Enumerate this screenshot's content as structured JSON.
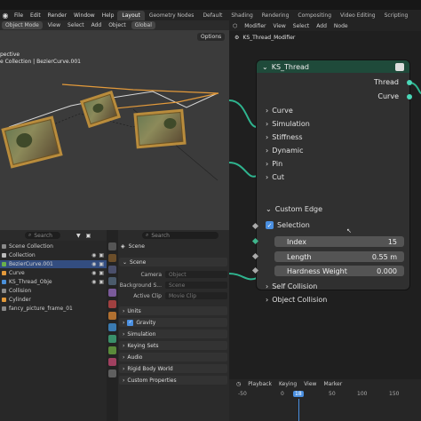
{
  "menubar": {
    "items": [
      "File",
      "Edit",
      "Render",
      "Window",
      "Help"
    ],
    "tabs": [
      "Layout",
      "Geometry Nodes",
      "Default",
      "Shading",
      "Rendering",
      "Compositing",
      "Video Editing",
      "Scripting"
    ],
    "active_tab": "Layout"
  },
  "viewport": {
    "mode": "Object Mode",
    "menus": [
      "View",
      "Select",
      "Add",
      "Object"
    ],
    "orientation": "Global",
    "options_label": "Options",
    "view_label": "pective",
    "collection_label": "e Collection | BezierCurve.001"
  },
  "outliner": {
    "search_placeholder": "Search",
    "rows": [
      {
        "label": "Scene Collection",
        "selected": false,
        "color": "#8a8a8a"
      },
      {
        "label": "Collection",
        "selected": false,
        "color": "#bbbbbb"
      },
      {
        "label": "BezierCurve.001",
        "selected": true,
        "color": "#6ab04c"
      },
      {
        "label": "Curve",
        "selected": false,
        "color": "#e39a3b"
      },
      {
        "label": "KS_Thread_Obje",
        "selected": false,
        "color": "#4a90d9"
      },
      {
        "label": "Collision",
        "selected": false,
        "color": "#8a8a8a"
      },
      {
        "label": "Cylinder",
        "selected": false,
        "color": "#e39a3b"
      },
      {
        "label": "fancy_picture_frame_01",
        "selected": false,
        "color": "#8a8a8a"
      }
    ]
  },
  "properties": {
    "search_placeholder": "Search",
    "scene_label": "Scene",
    "section_scene": "Scene",
    "fields": [
      {
        "label": "Camera",
        "value": "Object"
      },
      {
        "label": "Background S...",
        "value": "Scene"
      },
      {
        "label": "Active Clip",
        "value": "Movie Clip"
      }
    ],
    "sections": [
      "Units",
      "Gravity",
      "Simulation",
      "Keying Sets",
      "Audio",
      "Rigid Body World",
      "Custom Properties"
    ]
  },
  "node_editor": {
    "menus": [
      "Modifier",
      "View",
      "Select",
      "Add",
      "Node"
    ],
    "breadcrumb": "KS_Thread_Modifier",
    "node": {
      "title": "KS_Thread",
      "outputs": [
        "Thread",
        "Curve"
      ],
      "subpanels": [
        "Curve",
        "Simulation",
        "Stiffness",
        "Dynamic",
        "Pin",
        "Cut"
      ],
      "open_panel": "Custom Edge",
      "selection_label": "Selection",
      "fields": [
        {
          "label": "Index",
          "value": "15"
        },
        {
          "label": "Length",
          "value": "0.55 m"
        },
        {
          "label": "Hardness Weight",
          "value": "0.000"
        }
      ],
      "closed_panels": [
        "Self Collision",
        "Object Collision"
      ]
    }
  },
  "timeline": {
    "menus": [
      "Playback",
      "Keying",
      "View",
      "Marker"
    ],
    "numbers": [
      "-50",
      "0",
      "18",
      "50",
      "100",
      "150"
    ],
    "current_frame": "18"
  }
}
